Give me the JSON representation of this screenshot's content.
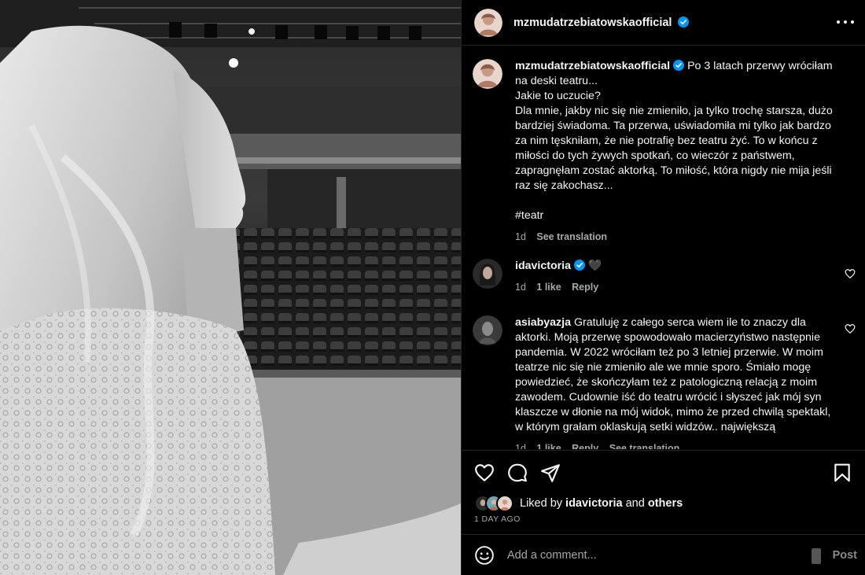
{
  "post": {
    "author": "mzmudatrzebiatowskaofficial",
    "verified": true
  },
  "caption": {
    "username": "mzmudatrzebiatowskaofficial",
    "text": "Po 3 latach przerwy wróciłam na deski teatru...\nJakie to uczucie?\nDla mnie, jakby nic się nie zmieniło, ja tylko trochę starsza, dużo bardziej świadoma. Ta przerwa, uświadomiła mi tylko jak bardzo za nim tęskniłam, że nie potrafię bez teatru żyć. To w końcu z miłości do tych żywych spotkań, co wieczór z państwem, zapragnęłam zostać aktorką. To miłość, która nigdy nie mija jeśli raz się zakochasz...",
    "hashtag": "#teatr",
    "time": "1d",
    "translation_link": "See translation"
  },
  "comments": [
    {
      "username": "idavictoria",
      "verified": true,
      "text": "🖤",
      "time": "1d",
      "likes": "1 like",
      "reply": "Reply"
    },
    {
      "username": "asiabyazja",
      "verified": false,
      "text": "Gratuluję z całego serca wiem ile to znaczy dla aktorki. Moją przerwę spowodowało macierzyństwo następnie pandemia. W 2022 wróciłam też po 3 letniej przerwie. W moim teatrze nic się nie zmieniło ale we mnie sporo. Śmiało mogę powiedzieć, że skończyłam też z patologiczną relacją z moim zawodem. Cudownie iść do teatru wrócić i słyszeć jak mój syn klaszcze w dłonie na mój widok, mimo że przed chwilą spektakl, w którym grałam oklaskują setki widzów.. największą",
      "time": "1d",
      "likes": "1 like",
      "reply": "Reply",
      "translation_link": "See translation"
    }
  ],
  "likes": {
    "prefix": "Liked by",
    "user": "idavictoria",
    "conjunction": "and",
    "others": "others"
  },
  "date": "1 DAY AGO",
  "add_comment": {
    "placeholder": "Add a comment...",
    "post_label": "Post"
  },
  "icons": {
    "like": "heart-icon",
    "comment": "comment-icon",
    "share": "share-icon",
    "save": "bookmark-icon",
    "emoji": "emoji-icon",
    "more": "more-options-icon"
  },
  "colors": {
    "background": "#000000",
    "text": "#f5f5f5",
    "secondary_text": "#a8a8a8",
    "verified": "#0095f6",
    "divider": "#262626"
  }
}
